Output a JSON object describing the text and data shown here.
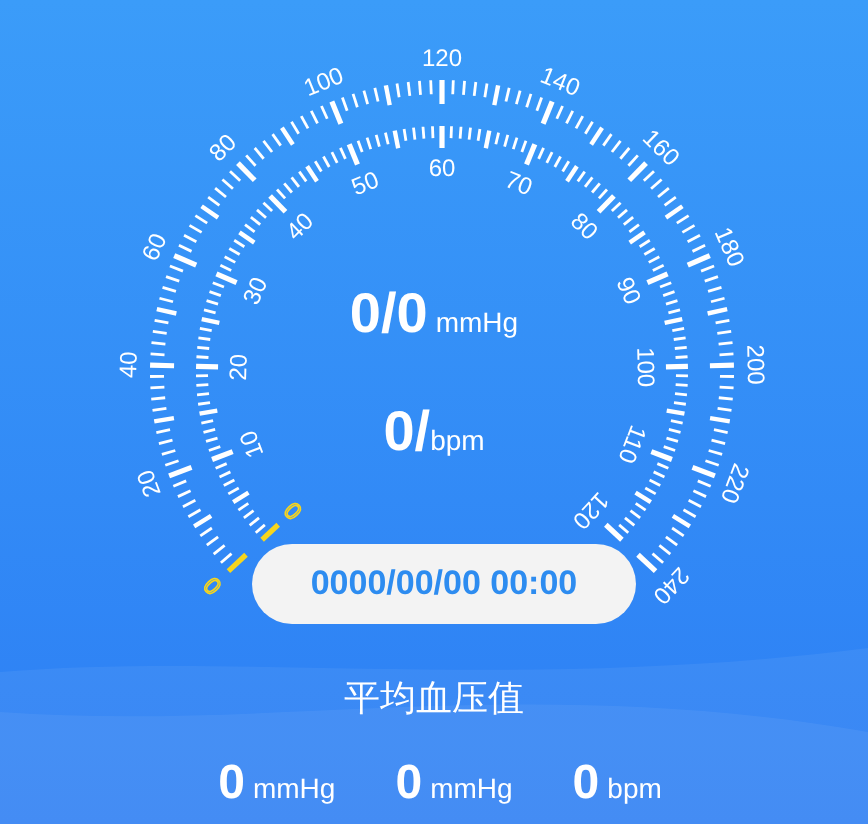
{
  "gauge": {
    "outer_scale": [
      {
        "text": "0",
        "highlighted": true
      },
      {
        "text": "20",
        "highlighted": false
      },
      {
        "text": "40",
        "highlighted": false
      },
      {
        "text": "60",
        "highlighted": false
      },
      {
        "text": "80",
        "highlighted": false
      },
      {
        "text": "100",
        "highlighted": false
      },
      {
        "text": "120",
        "highlighted": false
      },
      {
        "text": "140",
        "highlighted": false
      },
      {
        "text": "160",
        "highlighted": false
      },
      {
        "text": "180",
        "highlighted": false
      },
      {
        "text": "200",
        "highlighted": false
      },
      {
        "text": "220",
        "highlighted": false
      },
      {
        "text": "240",
        "highlighted": false
      }
    ],
    "inner_scale": [
      {
        "text": "0",
        "highlighted": true
      },
      {
        "text": "10",
        "highlighted": false
      },
      {
        "text": "20",
        "highlighted": false
      },
      {
        "text": "30",
        "highlighted": false
      },
      {
        "text": "40",
        "highlighted": false
      },
      {
        "text": "50",
        "highlighted": false
      },
      {
        "text": "60",
        "highlighted": false
      },
      {
        "text": "70",
        "highlighted": false
      },
      {
        "text": "80",
        "highlighted": false
      },
      {
        "text": "90",
        "highlighted": false
      },
      {
        "text": "100",
        "highlighted": false
      },
      {
        "text": "110",
        "highlighted": false
      },
      {
        "text": "120",
        "highlighted": false
      }
    ],
    "pressure": {
      "value": "0/0",
      "unit": "mmHg"
    },
    "pulse": {
      "value": "0/",
      "unit": "bpm"
    },
    "datetime": "0000/00/00 00:00"
  },
  "average": {
    "title": "平均血压值",
    "values": [
      {
        "value": "0",
        "unit": "mmHg"
      },
      {
        "value": "0",
        "unit": "mmHg"
      },
      {
        "value": "0",
        "unit": "bpm"
      }
    ]
  }
}
